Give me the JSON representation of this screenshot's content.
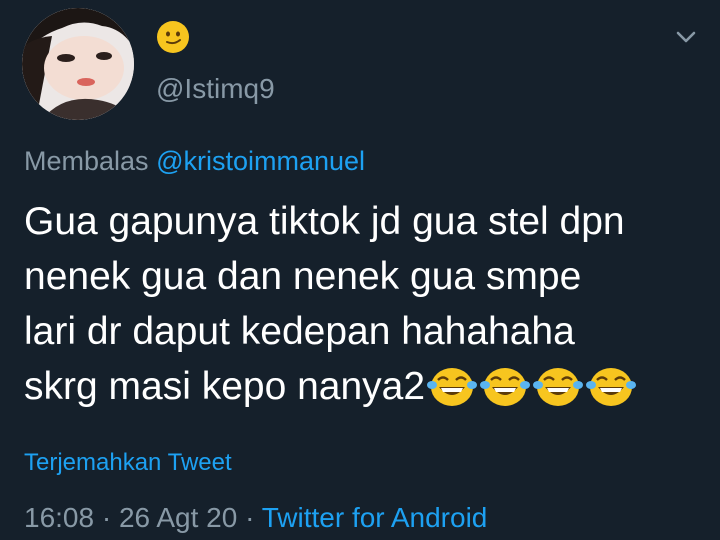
{
  "tweet": {
    "handle": "@Istimq9",
    "display_name_emoji": "smirking-face-icon",
    "reply_prefix": "Membalas",
    "reply_mention": "@kristoimmanuel",
    "text_lines": [
      "Gua gapunya tiktok jd gua stel dpn",
      "nenek gua dan nenek gua smpe",
      "lari dr daput kedepan hahahaha",
      "skrg masi kepo nanya2"
    ],
    "trailing_emojis": [
      "laughing-crying-icon",
      "laughing-crying-icon",
      "laughing-crying-icon",
      "laughing-crying-icon"
    ],
    "translate_label": "Terjemahkan Tweet",
    "time": "16:08",
    "separator": "·",
    "date": "26 Agt 20",
    "source": "Twitter for Android"
  },
  "colors": {
    "background": "#15202b",
    "text_primary": "#ffffff",
    "text_secondary": "#8899a6",
    "accent": "#1da1f2",
    "emoji_yellow": "#f7c51f"
  }
}
